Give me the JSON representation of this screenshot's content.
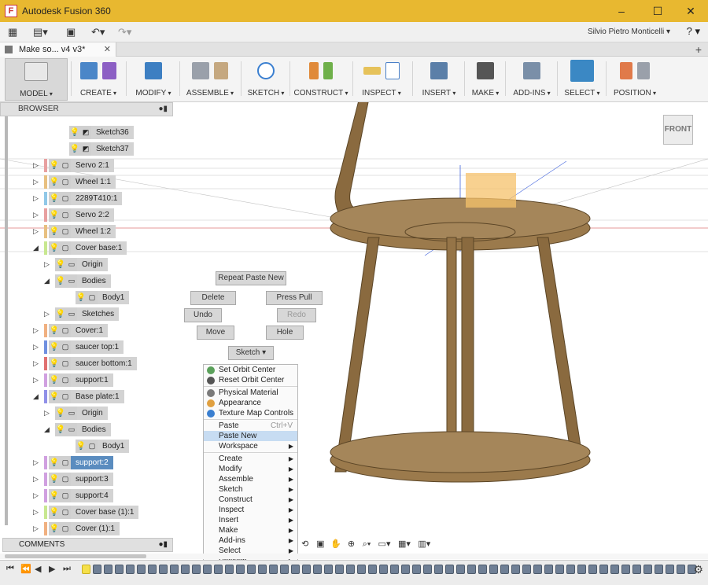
{
  "window": {
    "app_title": "Autodesk Fusion 360",
    "logo": "F",
    "min": "–",
    "max": "☐",
    "close": "✕"
  },
  "quick_access": {
    "user": "Silvio Pietro Monticelli ▾",
    "help": "? ▾"
  },
  "document_tab": {
    "label": "Make so... v4 v3*",
    "close": "✕",
    "new_tab": "+"
  },
  "toolbar": {
    "groups": [
      {
        "label": "MODEL"
      },
      {
        "label": "CREATE"
      },
      {
        "label": "MODIFY"
      },
      {
        "label": "ASSEMBLE"
      },
      {
        "label": "SKETCH"
      },
      {
        "label": "CONSTRUCT"
      },
      {
        "label": "INSPECT"
      },
      {
        "label": "INSERT"
      },
      {
        "label": "MAKE"
      },
      {
        "label": "ADD-INS"
      },
      {
        "label": "SELECT"
      },
      {
        "label": "POSITION"
      }
    ]
  },
  "browser": {
    "title": "BROWSER",
    "items": [
      {
        "label": "Sketch36"
      },
      {
        "label": "Sketch37"
      },
      {
        "label": "Servo 2:1"
      },
      {
        "label": "Wheel 1:1"
      },
      {
        "label": "2289T410:1"
      },
      {
        "label": "Servo 2:2"
      },
      {
        "label": "Wheel 1:2"
      },
      {
        "label": "Cover base:1"
      },
      {
        "label": "Origin"
      },
      {
        "label": "Bodies"
      },
      {
        "label": "Body1"
      },
      {
        "label": "Sketches"
      },
      {
        "label": "Cover:1"
      },
      {
        "label": "saucer top:1"
      },
      {
        "label": "saucer bottom:1"
      },
      {
        "label": "support:1"
      },
      {
        "label": "Base plate:1"
      },
      {
        "label": "Origin"
      },
      {
        "label": "Bodies"
      },
      {
        "label": "Body1"
      },
      {
        "label": "support:2"
      },
      {
        "label": "support:3"
      },
      {
        "label": "support:4"
      },
      {
        "label": "Cover base (1):1"
      },
      {
        "label": "Cover (1):1"
      }
    ]
  },
  "comments": {
    "title": "COMMENTS"
  },
  "marking_menu": {
    "repeat": "Repeat Paste New",
    "delete": "Delete",
    "press_pull": "Press Pull",
    "undo": "Undo",
    "redo": "Redo",
    "move": "Move",
    "hole": "Hole",
    "sketch": "Sketch"
  },
  "context_menu": {
    "items": [
      {
        "label": "Set Orbit Center"
      },
      {
        "label": "Reset Orbit Center"
      },
      {
        "label": "Physical Material"
      },
      {
        "label": "Appearance"
      },
      {
        "label": "Texture Map Controls"
      },
      {
        "label": "Paste",
        "shortcut": "Ctrl+V"
      },
      {
        "label": "Paste New"
      },
      {
        "label": "Workspace"
      },
      {
        "label": "Create"
      },
      {
        "label": "Modify"
      },
      {
        "label": "Assemble"
      },
      {
        "label": "Sketch"
      },
      {
        "label": "Construct"
      },
      {
        "label": "Inspect"
      },
      {
        "label": "Insert"
      },
      {
        "label": "Make"
      },
      {
        "label": "Add-ins"
      },
      {
        "label": "Select"
      },
      {
        "label": "Position"
      }
    ]
  },
  "viewcube": {
    "face": "FRONT"
  },
  "colors": {
    "title_bar": "#e8b830",
    "select_blue": "#5a8cbf",
    "wood": "#8a6a3f"
  }
}
